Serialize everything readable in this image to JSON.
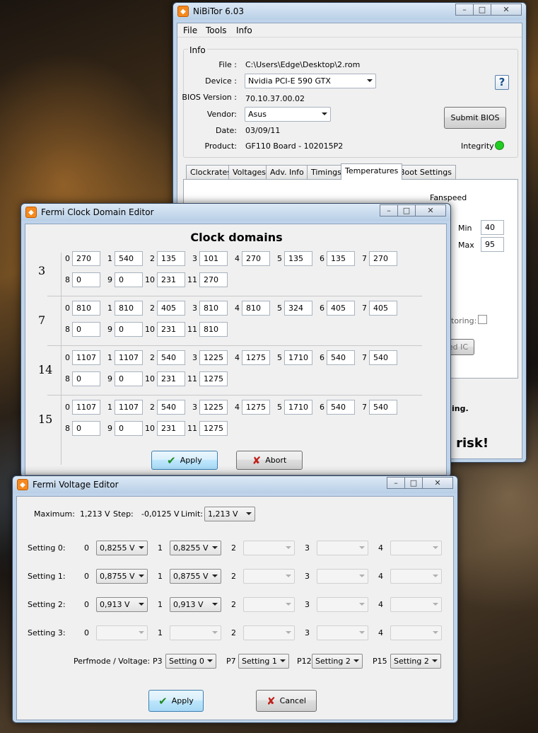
{
  "main": {
    "title": "NiBiTor 6.03",
    "menu": [
      "File",
      "Tools",
      "Info"
    ],
    "info_group": "Info",
    "file_label": "File :",
    "file_value": "C:\\Users\\Edge\\Desktop\\2.rom",
    "device_label": "Device :",
    "device_value": "Nvidia PCI-E 590 GTX",
    "bios_label": "BIOS Version :",
    "bios_value": "70.10.37.00.02",
    "vendor_label": "Vendor:",
    "vendor_value": "Asus",
    "date_label": "Date:",
    "date_value": "03/09/11",
    "product_label": "Product:",
    "product_value": "GF110 Board - 102015P2",
    "help_glyph": "?",
    "submit_label": "Submit BIOS",
    "integrity_label": "Integrity :",
    "integrity_color": "#22cc22",
    "tabs": [
      "Clockrates",
      "Voltages",
      "Adv. Info",
      "Timings",
      "Temperatures",
      "Boot Settings"
    ],
    "fanspeed_label": "Fanspeed",
    "min_label": "Min",
    "min_value": "40",
    "max_label": "Max",
    "max_value": "95",
    "monitoring_text": "itoring:",
    "ic_button_text": "ed IC",
    "warning_small": "ing.",
    "warning_big": "n risk!"
  },
  "clock": {
    "title": "Fermi Clock Domain Editor",
    "heading": "Clock domains",
    "groups": [
      {
        "label": "3",
        "row1": [
          "270",
          "540",
          "135",
          "101",
          "270",
          "135",
          "135",
          "270"
        ],
        "row2": [
          "0",
          "0",
          "231",
          "270"
        ]
      },
      {
        "label": "7",
        "row1": [
          "810",
          "810",
          "405",
          "810",
          "810",
          "324",
          "405",
          "405"
        ],
        "row2": [
          "0",
          "0",
          "231",
          "810"
        ]
      },
      {
        "label": "14",
        "row1": [
          "1107",
          "1107",
          "540",
          "1225",
          "1275",
          "1710",
          "540",
          "540"
        ],
        "row2": [
          "0",
          "0",
          "231",
          "1275"
        ]
      },
      {
        "label": "15",
        "row1": [
          "1107",
          "1107",
          "540",
          "1225",
          "1275",
          "1710",
          "540",
          "540"
        ],
        "row2": [
          "0",
          "0",
          "231",
          "1275"
        ]
      }
    ],
    "row1_idx": [
      "0",
      "1",
      "2",
      "3",
      "4",
      "5",
      "6",
      "7"
    ],
    "row2_idx": [
      "8",
      "9",
      "10",
      "11"
    ],
    "apply": "Apply",
    "abort": "Abort"
  },
  "volt": {
    "title": "Fermi Voltage Editor",
    "maximum_label": "Maximum:",
    "maximum_value": "1,213 V",
    "step_label": "Step:",
    "step_value": "-0,0125 V",
    "limit_label": "Limit:",
    "limit_value": "1,213 V",
    "idx": [
      "0",
      "1",
      "2",
      "3",
      "4"
    ],
    "settings": [
      {
        "label": "Setting 0:",
        "values": [
          "0,8255 V",
          "0,8255 V",
          "",
          "",
          ""
        ]
      },
      {
        "label": "Setting 1:",
        "values": [
          "0,8755 V",
          "0,8755 V",
          "",
          "",
          ""
        ]
      },
      {
        "label": "Setting 2:",
        "values": [
          "0,913 V",
          "0,913 V",
          "",
          "",
          ""
        ]
      },
      {
        "label": "Setting 3:",
        "values": [
          "",
          "",
          "",
          "",
          ""
        ]
      }
    ],
    "perf_label": "Perfmode / Voltage:",
    "perf": [
      {
        "p": "P3",
        "v": "Setting 0"
      },
      {
        "p": "P7",
        "v": "Setting 1"
      },
      {
        "p": "P12",
        "v": "Setting 2"
      },
      {
        "p": "P15",
        "v": "Setting 2"
      }
    ],
    "apply": "Apply",
    "cancel": "Cancel"
  }
}
